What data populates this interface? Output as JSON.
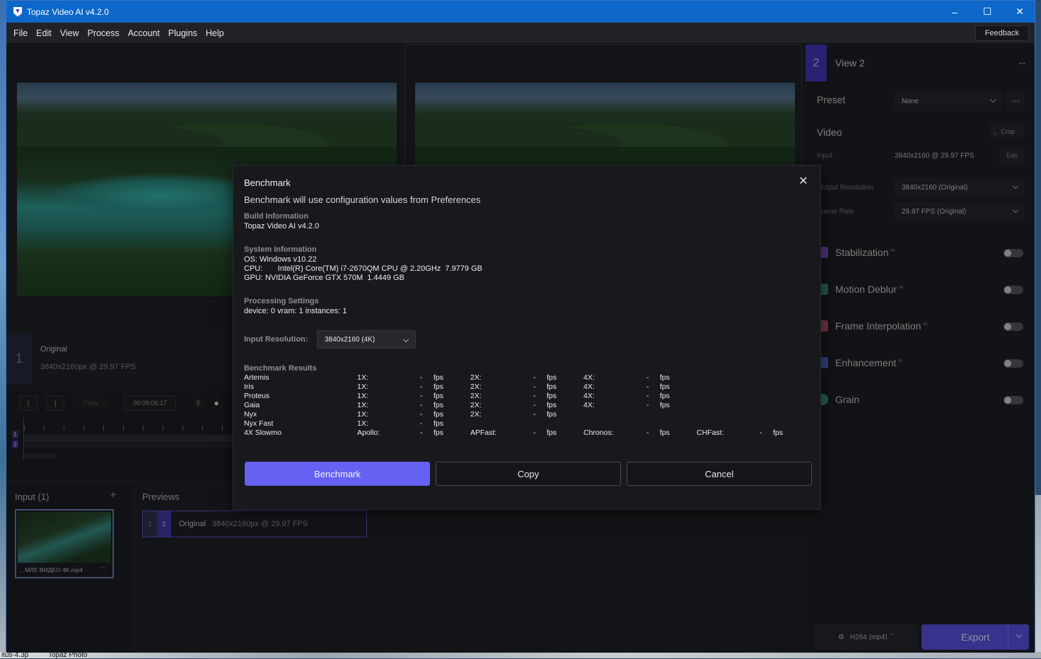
{
  "window": {
    "title": "Topaz Video AI  v4.2.0"
  },
  "menu": {
    "items": [
      "File",
      "Edit",
      "View",
      "Process",
      "Account",
      "Plugins",
      "Help"
    ],
    "feedback": "Feedback"
  },
  "original_panel": {
    "number": "1",
    "title": "Original",
    "info": "3840x2160px @ 29.97 FPS"
  },
  "toolbar": {
    "in_mark": "[",
    "out_mark": "]",
    "clear": "Clear",
    "timecode": "00:09:06;17",
    "timeline_start": "00:00:00;00"
  },
  "input": {
    "header": "Input (1)",
    "file_name": "...МЛЕ ВИДЕО 4K.mp4"
  },
  "previews": {
    "header": "Previews",
    "row": {
      "n1": "1",
      "n2": "2",
      "label": "Original",
      "info": "3840x2160px @ 29.97 FPS"
    }
  },
  "side": {
    "view_number": "2",
    "view_title": "View 2",
    "preset_label": "Preset",
    "preset_value": "None",
    "video_label": "Video",
    "crop_label": "Crop",
    "input_label": "Input",
    "input_value": "3840x2160 @ 29.97 FPS",
    "edit_label": "Edit",
    "output_res_label": "Output Resolution",
    "output_res_value": "3840x2160 (Original)",
    "frame_rate_label": "Frame Rate",
    "frame_rate_value": "29.97 FPS (Original)",
    "features": [
      {
        "name": "Stabilization",
        "ai": "AI",
        "color": "#7a4fc0"
      },
      {
        "name": "Motion Deblur",
        "ai": "AI",
        "color": "#3a8a6a"
      },
      {
        "name": "Frame Interpolation",
        "ai": "AI",
        "color": "#c06a30"
      },
      {
        "name": "Enhancement",
        "ai": "AI",
        "color": "#4a6ac8"
      },
      {
        "name": "Grain",
        "ai": "",
        "color": "#3a9a7a"
      }
    ],
    "codec": "H264 (mp4)",
    "export_label": "Export"
  },
  "dialog": {
    "title": "Benchmark",
    "subtitle": "Benchmark will use configuration values from Preferences",
    "build_header": "Build Information",
    "build_value": "Topaz Video AI v4.2.0",
    "system_header": "System Information",
    "os_line": "OS: Windows v10.22",
    "cpu_line": "CPU:       Intel(R) Core(TM) i7-2670QM CPU @ 2.20GHz  7.9779 GB",
    "gpu_line": "GPU: NVIDIA GeForce GTX 570M  1.4449 GB",
    "proc_header": "Processing Settings",
    "proc_value": "device: 0 vram: 1 instances: 1",
    "res_label": "Input Resolution:",
    "res_value": "3840x2160 (4K)",
    "results_header": "Benchmark Results",
    "results": [
      {
        "model": "Artemis",
        "cols": [
          [
            "1X:",
            "-",
            "fps"
          ],
          [
            "2X:",
            "-",
            "fps"
          ],
          [
            "4X:",
            "-",
            "fps"
          ]
        ]
      },
      {
        "model": "Iris",
        "cols": [
          [
            "1X:",
            "-",
            "fps"
          ],
          [
            "2X:",
            "-",
            "fps"
          ],
          [
            "4X:",
            "-",
            "fps"
          ]
        ]
      },
      {
        "model": "Proteus",
        "cols": [
          [
            "1X:",
            "-",
            "fps"
          ],
          [
            "2X:",
            "-",
            "fps"
          ],
          [
            "4X:",
            "-",
            "fps"
          ]
        ]
      },
      {
        "model": "Gaia",
        "cols": [
          [
            "1X:",
            "-",
            "fps"
          ],
          [
            "2X:",
            "-",
            "fps"
          ],
          [
            "4X:",
            "-",
            "fps"
          ]
        ]
      },
      {
        "model": "Nyx",
        "cols": [
          [
            "1X:",
            "-",
            "fps"
          ],
          [
            "2X:",
            "-",
            "fps"
          ]
        ]
      },
      {
        "model": "Nyx Fast",
        "cols": [
          [
            "1X:",
            "-",
            "fps"
          ]
        ]
      },
      {
        "model": "4X Slowmo",
        "cols": [
          [
            "Apollo:",
            "-",
            "fps"
          ],
          [
            "APFast:",
            "-",
            "fps"
          ],
          [
            "Chronos:",
            "-",
            "fps"
          ],
          [
            "CHFast:",
            "-",
            "fps"
          ]
        ]
      }
    ],
    "btn_benchmark": "Benchmark",
    "btn_copy": "Copy",
    "btn_cancel": "Cancel"
  },
  "taskbar": {
    "left_text": "itus-4.3p",
    "right_text": "Topaz Photo"
  }
}
